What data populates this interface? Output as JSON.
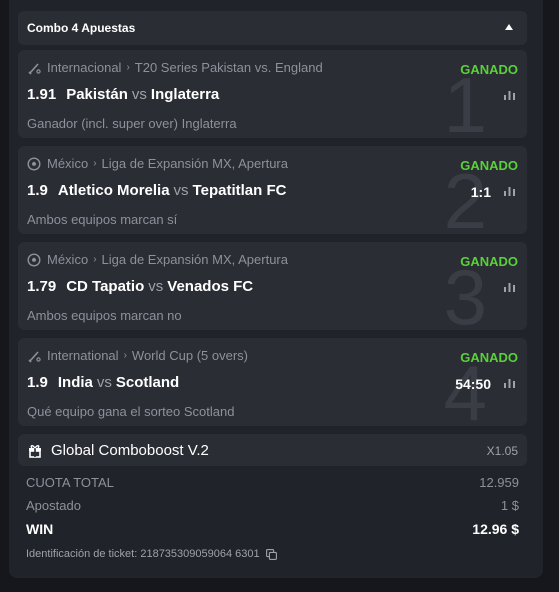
{
  "combo": {
    "title": "Combo 4 Apuestas",
    "toggle_icon": "caret-up-icon"
  },
  "legs": [
    {
      "number": "1",
      "sport_icon": "cricket-icon",
      "country": "Internacional",
      "league": "T20 Series Pakistan vs. England",
      "status": "GANADO",
      "odds": "1.91",
      "team_home": "Pakistán",
      "vs": "vs",
      "team_away": "Inglaterra",
      "score": "",
      "market": "Ganador (incl. super over) Inglaterra"
    },
    {
      "number": "2",
      "sport_icon": "soccer-ball-icon",
      "country": "México",
      "league": "Liga de Expansión MX, Apertura",
      "status": "GANADO",
      "odds": "1.9",
      "team_home": "Atletico Morelia",
      "vs": "vs",
      "team_away": "Tepatitlan FC",
      "score": "1:1",
      "market": "Ambos equipos marcan sí"
    },
    {
      "number": "3",
      "sport_icon": "soccer-ball-icon",
      "country": "México",
      "league": "Liga de Expansión MX, Apertura",
      "status": "GANADO",
      "odds": "1.79",
      "team_home": "CD Tapatio",
      "vs": "vs",
      "team_away": "Venados FC",
      "score": "",
      "market": "Ambos equipos marcan no"
    },
    {
      "number": "4",
      "sport_icon": "cricket-icon",
      "country": "International",
      "league": "World Cup (5 overs)",
      "status": "GANADO",
      "odds": "1.9",
      "team_home": "India",
      "vs": "vs",
      "team_away": "Scotland",
      "score": "54:50",
      "market": "Qué equipo gana el sorteo Scotland"
    }
  ],
  "boost": {
    "icon": "gift-icon",
    "label": "Global Comboboost V.2",
    "multiplier": "X1.05"
  },
  "summary": {
    "total_odds_label": "CUOTA TOTAL",
    "total_odds_value": "12.959",
    "stake_label": "Apostado",
    "stake_value": "1 $",
    "win_label": "WIN",
    "win_value": "12.96 $"
  },
  "ticket": {
    "label": "Identificación de ticket: 218735309059064 6301",
    "copy_icon": "copy-icon"
  },
  "colors": {
    "background": "#15171c",
    "panel": "#20232a",
    "card": "#2a2d34",
    "status_won": "#5bd138",
    "muted_text": "#8d919b"
  }
}
